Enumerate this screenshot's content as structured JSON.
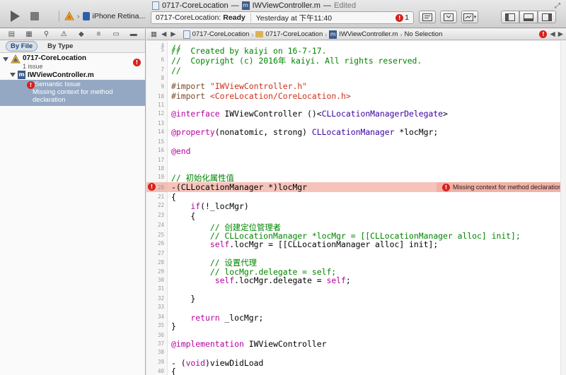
{
  "window": {
    "project": "0717-CoreLocation",
    "dash": "—",
    "file": "IWViewController.m",
    "edited": "Edited"
  },
  "toolbar": {
    "run_icon": "play-icon",
    "stop_icon": "stop-icon",
    "device": "iPhone Retina...",
    "activity_project": "0717-CoreLocation:",
    "activity_status": "Ready",
    "activity_time": "Yesterday at 下午11:40",
    "issue_count": "1"
  },
  "navigator": {
    "filter_by_file": "By File",
    "filter_by_type": "By Type",
    "project_name": "0717-CoreLocation",
    "project_issues": "1 issue",
    "file_name": "IWViewController.m",
    "issue_type": "Semantic Issue",
    "issue_message": "Missing context for method declaration"
  },
  "jumpbar": {
    "crumbs": [
      "0717-CoreLocation",
      "0717-CoreLocation",
      "IWViewController.m",
      "No Selection"
    ]
  },
  "editor": {
    "error_message": "Missing context for method declaration",
    "line_numbers": [
      "4",
      "5",
      "6",
      "7",
      "8",
      "9",
      "10",
      "11",
      "12",
      "13",
      "14",
      "15",
      "16",
      "17",
      "18",
      "19",
      "20",
      "21",
      "22",
      "23",
      "24",
      "25",
      "26",
      "27",
      "28",
      "29",
      "30",
      "31",
      "32",
      "33",
      "34",
      "35",
      "36",
      "37",
      "38",
      "39",
      "40"
    ],
    "lines": {
      "l04": "//",
      "l05": "//  Created by kaiyi on 16-7-17.",
      "l06": "//  Copyright (c) 2016年 kaiyi. All rights reserved.",
      "l07": "//",
      "l09_kw": "#import ",
      "l09_str": "\"IWViewController.h\"",
      "l10_kw": "#import ",
      "l10_str": "<CoreLocation/CoreLocation.h>",
      "l12_kw": "@interface",
      "l12_a": " IWViewController ()<",
      "l12_t": "CLLocationManagerDelegate",
      "l12_b": ">",
      "l14_kw": "@property",
      "l14_a": "(nonatomic, strong) ",
      "l14_t": "CLLocationManager",
      "l14_b": " *locMgr;",
      "l16_kw": "@end",
      "l19": "// 初始化属性值",
      "l20": "-(CLLocationManager *)locMgr",
      "l21": "{",
      "l22_kw": "    if",
      "l22_a": "(!_locMgr)",
      "l23": "    {",
      "l24": "        // 创建定位管理者",
      "l25": "        // CLLocationManager *locMgr = [[CLLocationManager alloc] init];",
      "l26_kw": "        self",
      "l26_a": ".locMgr = [[CLLocationManager alloc] init];",
      "l28": "        // 设置代理",
      "l29": "        // locMgr.delegate = self;",
      "l30_kw": "         self",
      "l30_a": ".locMgr.delegate = ",
      "l30_kw2": "self",
      "l30_b": ";",
      "l32": "    }",
      "l34_kw": "    return",
      "l34_a": " _locMgr;",
      "l35": "}",
      "l37_kw": "@implementation",
      "l37_a": " IWViewController",
      "l39_a": "- (",
      "l39_kw": "void",
      "l39_b": ")viewDidLoad",
      "l40": "{"
    }
  },
  "colors": {
    "comment": "#008400",
    "keyword": "#b4009e",
    "string": "#d12f1b",
    "type": "#3900a0",
    "error_band": "#f6c3ba",
    "selection": "#95a8c3"
  }
}
